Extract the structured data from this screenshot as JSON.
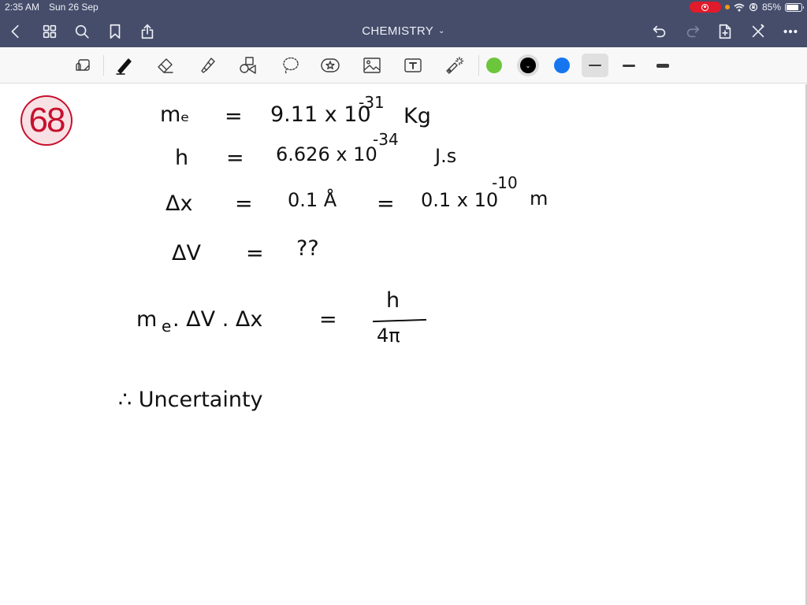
{
  "status_bar": {
    "time": "2:35 AM",
    "date": "Sun 26 Sep",
    "battery_percent": "85%",
    "battery_level": 0.85,
    "icons": [
      "screen-recording-icon",
      "orange-dot-indicator",
      "wifi-icon",
      "orientation-lock-icon",
      "battery-icon"
    ]
  },
  "nav_bar": {
    "title": "CHEMISTRY",
    "title_chevron": "⌄",
    "left_icons": [
      "back-icon",
      "thumbnails-grid-icon",
      "search-icon",
      "bookmark-icon",
      "share-icon"
    ],
    "right_icons": [
      "undo-icon",
      "redo-icon",
      "add-page-icon",
      "close-pen-icon",
      "more-icon"
    ],
    "redo_enabled": false
  },
  "toolbar": {
    "tools": [
      "read-only-toggle",
      "pen",
      "eraser",
      "highlighter",
      "shapes",
      "lasso",
      "elements-sticker",
      "image",
      "text-box",
      "laser-pointer"
    ],
    "active_tool": "pen",
    "bluetooth_indicator": "✱",
    "colors": [
      {
        "name": "green",
        "hex": "#6cc63b"
      },
      {
        "name": "black",
        "hex": "#000000",
        "selected": true
      },
      {
        "name": "blue",
        "hex": "#1576f0"
      }
    ],
    "stroke_widths": [
      "thin",
      "medium",
      "thick"
    ],
    "active_stroke": "thin"
  },
  "note": {
    "question_number": "68",
    "badge_color": "#c8102e",
    "lines": [
      {
        "lhs": "mₑ",
        "eq": "=",
        "value": "9.11 x 10",
        "exp": "-31",
        "unit": "Kg"
      },
      {
        "lhs": "h",
        "eq": "=",
        "value": "6.626 x 10",
        "exp": "-34",
        "unit": "J.s"
      },
      {
        "lhs": "Δx",
        "eq": "=",
        "value": "0.1 Å",
        "eq2": "=",
        "value2": "0.1 x 10",
        "exp": "-10",
        "unit": "m"
      },
      {
        "lhs": "ΔV",
        "eq": "=",
        "value": "??"
      }
    ],
    "formula": {
      "lhs_m": "m",
      "lhs_sub": "e",
      "lhs_rest": ". ΔV . Δx",
      "eq": "=",
      "numerator": "h",
      "denominator": "4π"
    },
    "conclusion": "∴  Uncertainty"
  }
}
